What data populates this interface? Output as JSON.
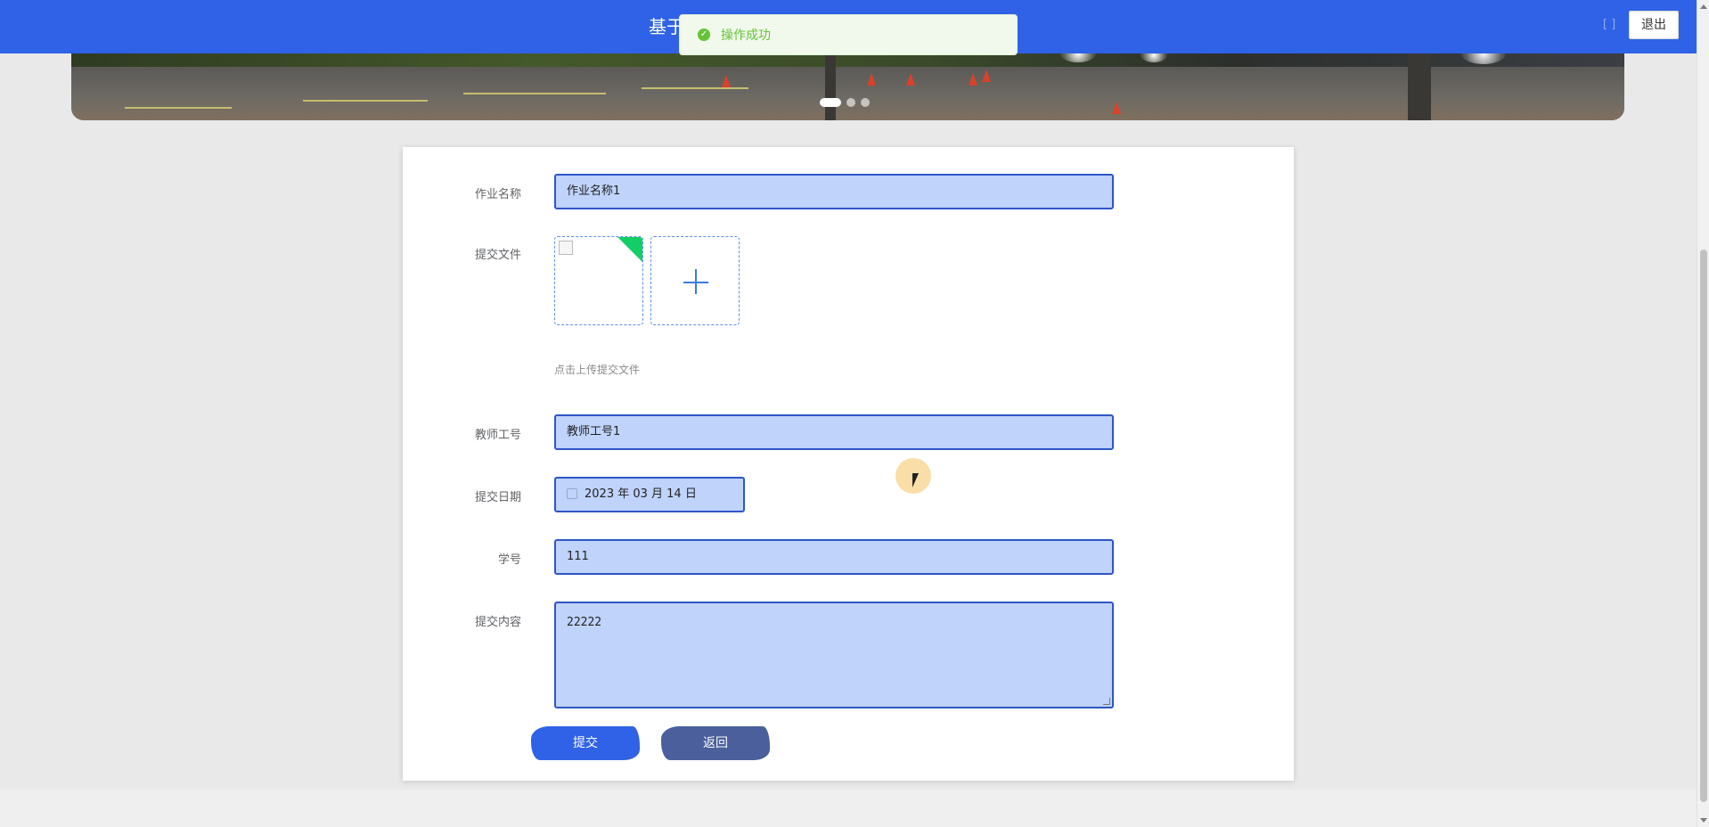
{
  "header": {
    "title": "基于",
    "logout_label": "退出",
    "icon_text": "[ ]"
  },
  "toast": {
    "message": "操作成功",
    "icon": "success-check-icon",
    "color": "#67c23a"
  },
  "carousel": {
    "active_index": 0,
    "dot_count": 3
  },
  "form": {
    "homework_name": {
      "label": "作业名称",
      "value": "作业名称1"
    },
    "submit_file": {
      "label": "提交文件",
      "hint": "点击上传提交文件"
    },
    "teacher_id": {
      "label": "教师工号",
      "value": "教师工号1"
    },
    "submit_date": {
      "label": "提交日期",
      "value": "2023 年 03 月 14 日"
    },
    "student_id": {
      "label": "学号",
      "value": "111"
    },
    "content": {
      "label": "提交内容",
      "value": "22222"
    },
    "submit_label": "提交",
    "back_label": "返回"
  },
  "colors": {
    "primary": "#2f62e6",
    "input_fill": "#bfd3fb",
    "input_border": "#2f55c6",
    "back_button": "#4a5f9c",
    "upload_badge": "#13ce66"
  }
}
